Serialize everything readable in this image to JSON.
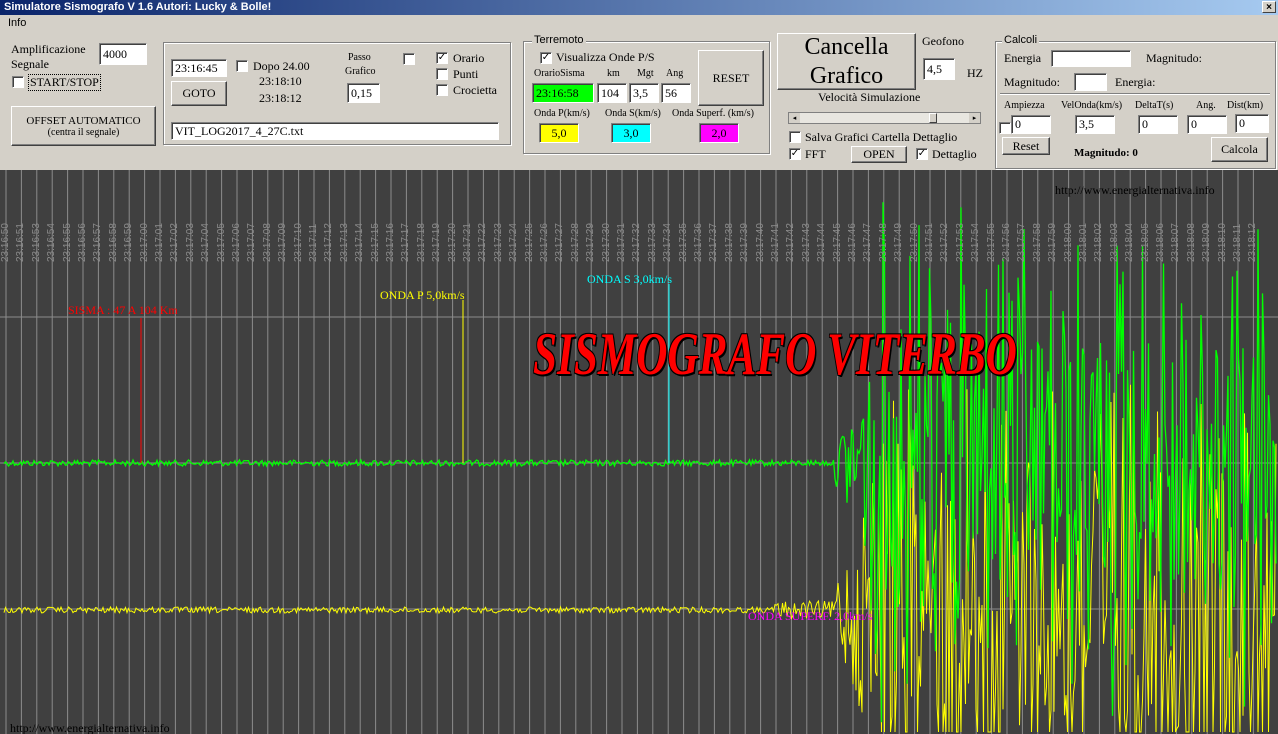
{
  "window": {
    "title": "Simulatore Sismografo V 1.6  Autori: Lucky & Bolle!",
    "close": "×"
  },
  "menu": {
    "info": "Info"
  },
  "amp": {
    "label1": "Amplificazione",
    "label2": "Segnale",
    "value": "4000",
    "start_stop": "START/STOP",
    "offset_line1": "OFFSET AUTOMATICO",
    "offset_line2": "(centra il segnale)"
  },
  "time": {
    "value": "23:16:45",
    "goto": "GOTO",
    "dopo": "Dopo 24.00",
    "t1": "23:18:10",
    "t2": "23:18:12",
    "passo1": "Passo",
    "passo2": "Grafico",
    "passo_value": "0,15",
    "orario": "Orario",
    "punti": "Punti",
    "crocietta": "Crocietta",
    "file": "VIT_LOG2017_4_27C.txt"
  },
  "terremoto": {
    "legend": "Terremoto",
    "visualizza": "Visualizza Onde P/S",
    "col_orario": "OrarioSisma",
    "col_km": "km",
    "col_mgt": "Mgt",
    "col_ang": "Ang",
    "orario": "23:16:58",
    "km": "104",
    "mgt": "3,5",
    "ang": "56",
    "reset": "RESET",
    "onda_p_label": "Onda P(km/s)",
    "onda_s_label": "Onda S(km/s)",
    "onda_sup_label": "Onda Superf. (km/s)",
    "onda_p": "5,0",
    "onda_s": "3,0",
    "onda_sup": "2,0"
  },
  "cancella": {
    "line1": "Cancella",
    "line2": "Grafico",
    "geofono": "Geofono",
    "geofono_value": "4,5",
    "hz": "HZ",
    "velocita": "Velocità Simulazione",
    "salva": "Salva Grafici Cartella Dettaglio",
    "fft": "FFT",
    "open": "OPEN",
    "dettaglio": "Dettaglio"
  },
  "calcoli": {
    "legend": "Calcoli",
    "energia": "Energia",
    "magnitudo": "Magnitudo:",
    "magnitudo2": "Magnitudo:",
    "energia2": "Energia:",
    "ampiezza": "Ampiezza",
    "velonda": "VelOnda(km/s)",
    "deltat": "DeltaT(s)",
    "ang": "Ang.",
    "dist": "Dist(km)",
    "v_amp": "0",
    "v_vel": "3,5",
    "v_delta": "0",
    "v_ang": "0",
    "v_dist": "0",
    "reset": "Reset",
    "magnitudo_result": "Magnitudo:  0",
    "calcola": "Calcola"
  },
  "plot": {
    "url_top": "http://www.energialternativa.info",
    "url_bottom": "http://www.energialternativa.info",
    "title": "SISMOGRAFO VITERBO",
    "sisma": "SISMA : 47 A 104 Km",
    "onda_p": "ONDA P 5,0km/s",
    "onda_s": "ONDA S 3,0km/s",
    "onda_sup": "ONDA SUPERF. 2,0km/s",
    "ticks": [
      "23:16:50",
      "23:16:51",
      "23:16:53",
      "23:16:54",
      "23:16:55",
      "23:16:56",
      "23:16:57",
      "23:16:58",
      "23:16:59",
      "23:17:00",
      "23:17:01",
      "23:17:02",
      "23:17:03",
      "23:17:04",
      "23:17:05",
      "23:17:06",
      "23:17:07",
      "23:17:08",
      "23:17:09",
      "23:17:10",
      "23:17:11",
      "23:17:12",
      "23:17:13",
      "23:17:14",
      "23:17:15",
      "23:17:16",
      "23:17:17",
      "23:17:18",
      "23:17:19",
      "23:17:20",
      "23:17:21",
      "23:17:22",
      "23:17:23",
      "23:17:24",
      "23:17:25",
      "23:17:26",
      "23:17:27",
      "23:17:28",
      "23:17:29",
      "23:17:30",
      "23:17:31",
      "23:17:32",
      "23:17:33",
      "23:17:34",
      "23:17:35",
      "23:17:36",
      "23:17:37",
      "23:17:38",
      "23:17:39",
      "23:17:40",
      "23:17:41",
      "23:17:42",
      "23:17:43",
      "23:17:44",
      "23:17:45",
      "23:17:46",
      "23:17:47",
      "23:17:48",
      "23:17:49",
      "23:17:50",
      "23:17:51",
      "23:17:52",
      "23:17:53",
      "23:17:54",
      "23:17:55",
      "23:17:56",
      "23:17:57",
      "23:17:58",
      "23:17:59",
      "23:18:00",
      "23:18:01",
      "23:18:02",
      "23:18:03",
      "23:18:04",
      "23:18:05",
      "23:18:06",
      "23:18:07",
      "23:18:08",
      "23:18:09",
      "23:18:10",
      "23:18:11",
      "23:18:12"
    ],
    "colors": {
      "green": "#00ff00",
      "yellow": "#ffff00",
      "red": "#ff0000",
      "cyan": "#00ffff",
      "magenta": "#ff00ff",
      "background": "#404040"
    }
  }
}
